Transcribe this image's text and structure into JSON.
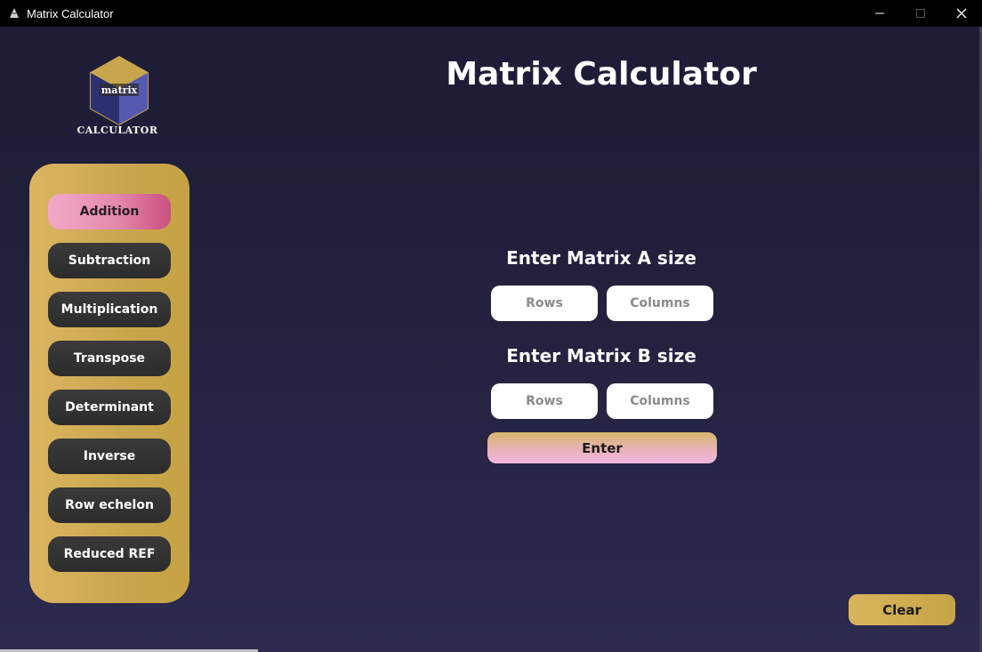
{
  "window": {
    "title": "Matrix Calculator",
    "app_icon": "matrix-app-icon",
    "controls": [
      "minimize",
      "maximize",
      "close"
    ]
  },
  "logo": {
    "text": "CALCULATOR",
    "emblem_text": "matrix"
  },
  "header": {
    "title": "Matrix Calculator"
  },
  "sidebar": {
    "items": [
      {
        "label": "Addition",
        "active": true
      },
      {
        "label": "Subtraction",
        "active": false
      },
      {
        "label": "Multiplication",
        "active": false
      },
      {
        "label": "Transpose",
        "active": false
      },
      {
        "label": "Determinant",
        "active": false
      },
      {
        "label": "Inverse",
        "active": false
      },
      {
        "label": "Row echelon",
        "active": false
      },
      {
        "label": "Reduced REF",
        "active": false
      }
    ]
  },
  "form": {
    "matrix_a_label": "Enter Matrix A size",
    "matrix_b_label": "Enter Matrix B size",
    "a_rows": {
      "placeholder": "Rows",
      "value": ""
    },
    "a_cols": {
      "placeholder": "Columns",
      "value": ""
    },
    "b_rows": {
      "placeholder": "Rows",
      "value": ""
    },
    "b_cols": {
      "placeholder": "Columns",
      "value": ""
    },
    "enter_label": "Enter"
  },
  "footer": {
    "clear_label": "Clear"
  },
  "colors": {
    "background_top": "#1d1c36",
    "background_bottom": "#2c2a50",
    "sidebar_gold": "#c9a64e",
    "active_pink": "#e48aae",
    "button_dark": "#2c2c2c"
  }
}
